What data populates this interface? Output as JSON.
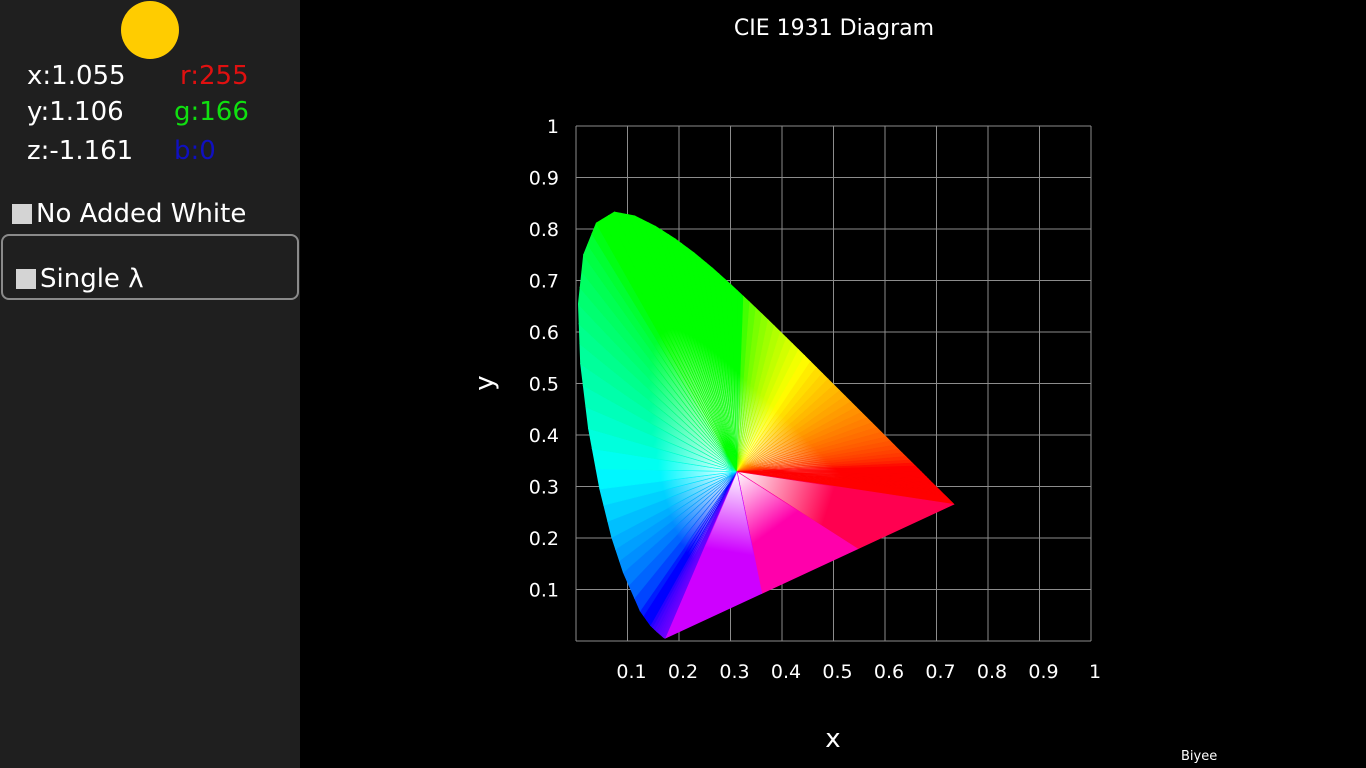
{
  "color_readout": {
    "swatch_color": "#FFCC00",
    "x": "x:1.055",
    "y": "y:1.106",
    "z": "z:-1.161",
    "r": "r:255",
    "g": "g:166",
    "b": "b:0",
    "r_color": "#e01010",
    "g_color": "#10e010",
    "b_color": "#1010c0"
  },
  "options": {
    "no_added_white": {
      "label": "No Added White",
      "checked": false
    },
    "single_lambda": {
      "label": "Single λ",
      "checked": false
    }
  },
  "chart_data": {
    "type": "scatter",
    "title": "CIE 1931 Diagram",
    "xlabel": "x",
    "ylabel": "y",
    "xlim": [
      0,
      1
    ],
    "ylim": [
      0,
      1
    ],
    "grid": true,
    "x_ticks": [
      "0.1",
      "0.2",
      "0.3",
      "0.4",
      "0.5",
      "0.6",
      "0.7",
      "0.8",
      "0.9",
      "1"
    ],
    "y_ticks": [
      "0.1",
      "0.2",
      "0.3",
      "0.4",
      "0.5",
      "0.6",
      "0.7",
      "0.8",
      "0.9",
      "1"
    ],
    "white_point": [
      0.3127,
      0.329
    ],
    "spectral_locus": [
      [
        0.1741,
        0.005
      ],
      [
        0.1738,
        0.0049
      ],
      [
        0.1736,
        0.0049
      ],
      [
        0.1733,
        0.0048
      ],
      [
        0.1726,
        0.0048
      ],
      [
        0.1714,
        0.0051
      ],
      [
        0.1689,
        0.0069
      ],
      [
        0.1644,
        0.0109
      ],
      [
        0.1566,
        0.0177
      ],
      [
        0.144,
        0.0297
      ],
      [
        0.1241,
        0.0578
      ],
      [
        0.0913,
        0.1327
      ],
      [
        0.0687,
        0.2007
      ],
      [
        0.0454,
        0.295
      ],
      [
        0.0235,
        0.4127
      ],
      [
        0.0082,
        0.5384
      ],
      [
        0.0039,
        0.6548
      ],
      [
        0.0139,
        0.7502
      ],
      [
        0.0389,
        0.812
      ],
      [
        0.0743,
        0.8338
      ],
      [
        0.1142,
        0.8262
      ],
      [
        0.1547,
        0.8059
      ],
      [
        0.1929,
        0.7816
      ],
      [
        0.2296,
        0.7543
      ],
      [
        0.2658,
        0.7243
      ],
      [
        0.3016,
        0.6923
      ],
      [
        0.3373,
        0.6589
      ],
      [
        0.3731,
        0.6245
      ],
      [
        0.4087,
        0.5896
      ],
      [
        0.4441,
        0.5547
      ],
      [
        0.4788,
        0.5202
      ],
      [
        0.5125,
        0.4866
      ],
      [
        0.5448,
        0.4544
      ],
      [
        0.5752,
        0.4242
      ],
      [
        0.6029,
        0.3965
      ],
      [
        0.627,
        0.3725
      ],
      [
        0.6482,
        0.3514
      ],
      [
        0.6658,
        0.334
      ],
      [
        0.6801,
        0.3197
      ],
      [
        0.6915,
        0.3083
      ],
      [
        0.7006,
        0.2993
      ],
      [
        0.7079,
        0.292
      ],
      [
        0.714,
        0.2859
      ],
      [
        0.719,
        0.2809
      ],
      [
        0.723,
        0.277
      ],
      [
        0.726,
        0.274
      ],
      [
        0.7283,
        0.2717
      ],
      [
        0.73,
        0.27
      ],
      [
        0.7311,
        0.2689
      ],
      [
        0.732,
        0.268
      ],
      [
        0.7327,
        0.2673
      ],
      [
        0.7334,
        0.2666
      ],
      [
        0.734,
        0.266
      ],
      [
        0.7344,
        0.2656
      ],
      [
        0.7346,
        0.2654
      ],
      [
        0.7347,
        0.2653
      ]
    ]
  },
  "credit": "Biyee"
}
